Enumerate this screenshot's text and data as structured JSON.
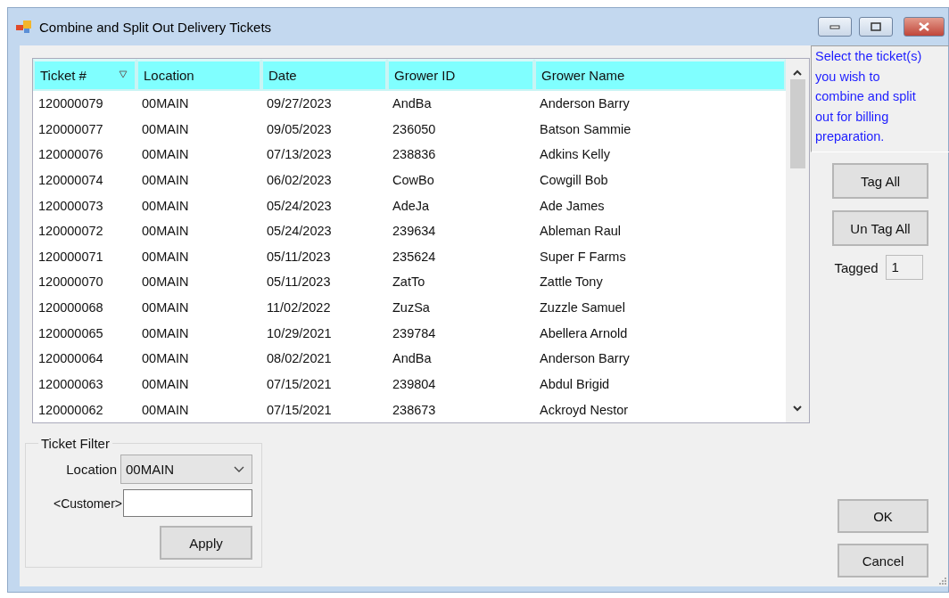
{
  "window": {
    "title": "Combine and Split Out Delivery Tickets"
  },
  "table": {
    "columns": [
      {
        "label": "Ticket #",
        "sorted": true
      },
      {
        "label": "Location",
        "sorted": false
      },
      {
        "label": "Date",
        "sorted": false
      },
      {
        "label": "Grower ID",
        "sorted": false
      },
      {
        "label": "Grower Name",
        "sorted": false
      }
    ],
    "rows": [
      [
        "120000079",
        "00MAIN",
        "09/27/2023",
        "AndBa",
        "Anderson Barry"
      ],
      [
        "120000077",
        "00MAIN",
        "09/05/2023",
        "236050",
        "Batson Sammie"
      ],
      [
        "120000076",
        "00MAIN",
        "07/13/2023",
        "238836",
        "Adkins Kelly"
      ],
      [
        "120000074",
        "00MAIN",
        "06/02/2023",
        "CowBo",
        "Cowgill Bob"
      ],
      [
        "120000073",
        "00MAIN",
        "05/24/2023",
        "AdeJa",
        "Ade James"
      ],
      [
        "120000072",
        "00MAIN",
        "05/24/2023",
        "239634",
        "Ableman Raul"
      ],
      [
        "120000071",
        "00MAIN",
        "05/11/2023",
        "235624",
        "Super F Farms"
      ],
      [
        "120000070",
        "00MAIN",
        "05/11/2023",
        "ZatTo",
        "Zattle Tony"
      ],
      [
        "120000068",
        "00MAIN",
        "11/02/2022",
        "ZuzSa",
        "Zuzzle Samuel"
      ],
      [
        "120000065",
        "00MAIN",
        "10/29/2021",
        "239784",
        "Abellera Arnold"
      ],
      [
        "120000064",
        "00MAIN",
        "08/02/2021",
        "AndBa",
        "Anderson Barry"
      ],
      [
        "120000063",
        "00MAIN",
        "07/15/2021",
        "239804",
        "Abdul Brigid"
      ],
      [
        "120000062",
        "00MAIN",
        "07/15/2021",
        "238673",
        "Ackroyd Nestor"
      ]
    ]
  },
  "instructions": "Select the ticket(s) you wish to combine and split out for billing preparation.",
  "tag_buttons": [
    "Tag All",
    "Un Tag All"
  ],
  "tagged": {
    "label": "Tagged",
    "value": "1"
  },
  "filter": {
    "title": "Ticket Filter",
    "location_label": "Location",
    "location_value": "00MAIN",
    "customer_label": "<Customer>",
    "apply": "Apply"
  },
  "buttons": [
    "OK",
    "Cancel"
  ]
}
